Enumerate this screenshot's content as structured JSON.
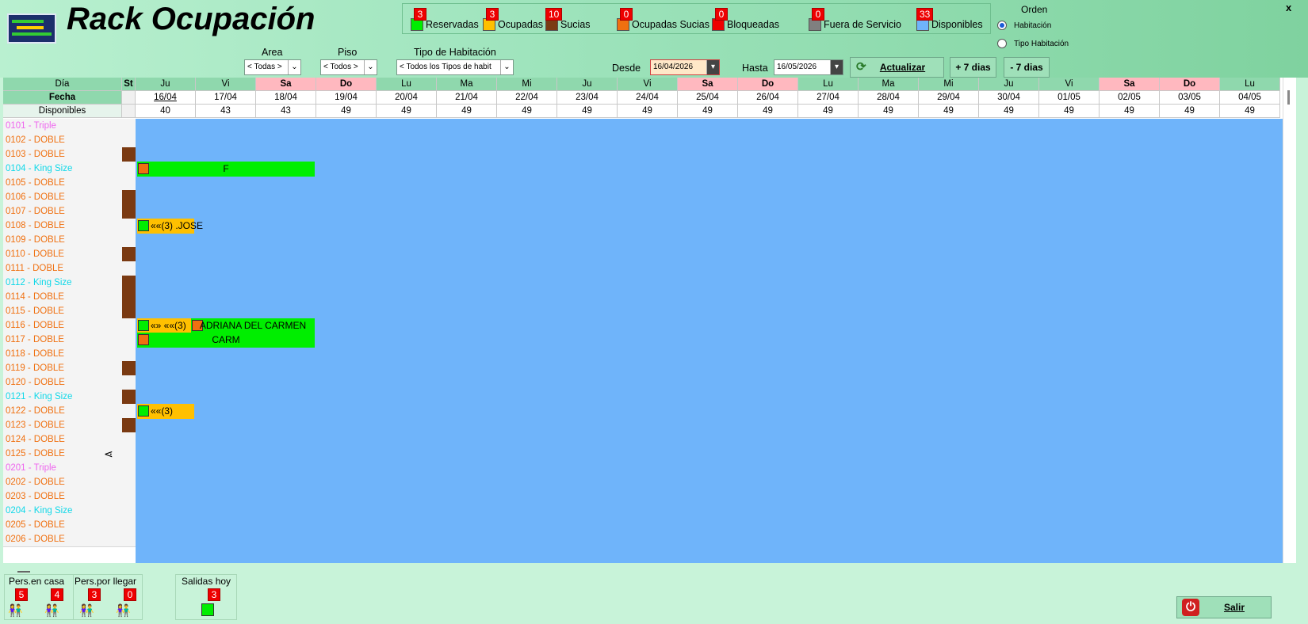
{
  "window": {
    "title": "Rack Ocupación",
    "close_label": "x"
  },
  "legend": [
    {
      "label": "Reservadas",
      "count": "3",
      "color": "#00ee00"
    },
    {
      "label": "Ocupadas",
      "count": "3",
      "color": "#ffc000"
    },
    {
      "label": "Sucias",
      "count": "10",
      "color": "#7a3a12"
    },
    {
      "label": "Ocupadas Sucias",
      "count": "0",
      "color": "#f07010"
    },
    {
      "label": "Bloqueadas",
      "count": "0",
      "color": "#ee0000"
    },
    {
      "label": "Fuera de Servicio",
      "count": "0",
      "color": "#808080"
    },
    {
      "label": "Disponibles",
      "count": "33",
      "color": "#6fb4fa"
    }
  ],
  "orden": {
    "title": "Orden",
    "options": [
      "Habitación",
      "Tipo Habitación"
    ],
    "selected": "Habitación"
  },
  "filters": {
    "area": {
      "label": "Area",
      "value": "< Todas >"
    },
    "piso": {
      "label": "Piso",
      "value": "< Todos >"
    },
    "tipo": {
      "label": "Tipo de Habitación",
      "value": "< Todos los Tipos de habit"
    },
    "desde": {
      "label": "Desde",
      "value": "16/04/2026"
    },
    "hasta": {
      "label": "Hasta",
      "value": "16/05/2026"
    }
  },
  "buttons": {
    "actualizar": "Actualizar",
    "mas7": "+ 7 dias",
    "menos7": "- 7 dias",
    "salir": "Salir"
  },
  "grid": {
    "header_labels": {
      "dia": "Día",
      "st": "St",
      "fecha": "Fecha",
      "disponibles": "Disponibles"
    },
    "days": [
      {
        "dia": "Ju",
        "fecha": "16/04",
        "disp": "40",
        "weekend": false
      },
      {
        "dia": "Vi",
        "fecha": "17/04",
        "disp": "43",
        "weekend": false
      },
      {
        "dia": "Sa",
        "fecha": "18/04",
        "disp": "43",
        "weekend": true
      },
      {
        "dia": "Do",
        "fecha": "19/04",
        "disp": "49",
        "weekend": true
      },
      {
        "dia": "Lu",
        "fecha": "20/04",
        "disp": "49",
        "weekend": false
      },
      {
        "dia": "Ma",
        "fecha": "21/04",
        "disp": "49",
        "weekend": false
      },
      {
        "dia": "Mi",
        "fecha": "22/04",
        "disp": "49",
        "weekend": false
      },
      {
        "dia": "Ju",
        "fecha": "23/04",
        "disp": "49",
        "weekend": false
      },
      {
        "dia": "Vi",
        "fecha": "24/04",
        "disp": "49",
        "weekend": false
      },
      {
        "dia": "Sa",
        "fecha": "25/04",
        "disp": "49",
        "weekend": true
      },
      {
        "dia": "Do",
        "fecha": "26/04",
        "disp": "49",
        "weekend": true
      },
      {
        "dia": "Lu",
        "fecha": "27/04",
        "disp": "49",
        "weekend": false
      },
      {
        "dia": "Ma",
        "fecha": "28/04",
        "disp": "49",
        "weekend": false
      },
      {
        "dia": "Mi",
        "fecha": "29/04",
        "disp": "49",
        "weekend": false
      },
      {
        "dia": "Ju",
        "fecha": "30/04",
        "disp": "49",
        "weekend": false
      },
      {
        "dia": "Vi",
        "fecha": "01/05",
        "disp": "49",
        "weekend": false
      },
      {
        "dia": "Sa",
        "fecha": "02/05",
        "disp": "49",
        "weekend": true
      },
      {
        "dia": "Do",
        "fecha": "03/05",
        "disp": "49",
        "weekend": true
      },
      {
        "dia": "Lu",
        "fecha": "04/05",
        "disp": "49",
        "weekend": false
      }
    ],
    "rooms": [
      {
        "name": "0101 - Triple",
        "type": "triple",
        "dirty": false
      },
      {
        "name": "0102 - DOBLE",
        "type": "doble",
        "dirty": false
      },
      {
        "name": "0103 - DOBLE",
        "type": "doble",
        "dirty": true
      },
      {
        "name": "0104 - King Size",
        "type": "king",
        "dirty": false
      },
      {
        "name": "0105 - DOBLE",
        "type": "doble",
        "dirty": false
      },
      {
        "name": "0106 - DOBLE",
        "type": "doble",
        "dirty": true
      },
      {
        "name": "0107 - DOBLE",
        "type": "doble",
        "dirty": true
      },
      {
        "name": "0108 - DOBLE",
        "type": "doble",
        "dirty": false
      },
      {
        "name": "0109 - DOBLE",
        "type": "doble",
        "dirty": false
      },
      {
        "name": "0110 - DOBLE",
        "type": "doble",
        "dirty": true
      },
      {
        "name": "0111 - DOBLE",
        "type": "doble",
        "dirty": false
      },
      {
        "name": "0112 - King Size",
        "type": "king",
        "dirty": true
      },
      {
        "name": "0114 - DOBLE",
        "type": "doble",
        "dirty": true
      },
      {
        "name": "0115 - DOBLE",
        "type": "doble",
        "dirty": true
      },
      {
        "name": "0116 - DOBLE",
        "type": "doble",
        "dirty": false
      },
      {
        "name": "0117 - DOBLE",
        "type": "doble",
        "dirty": false
      },
      {
        "name": "0118 - DOBLE",
        "type": "doble",
        "dirty": false
      },
      {
        "name": "0119 - DOBLE",
        "type": "doble",
        "dirty": true
      },
      {
        "name": "0120 - DOBLE",
        "type": "doble",
        "dirty": false
      },
      {
        "name": "0121 - King Size",
        "type": "king",
        "dirty": true
      },
      {
        "name": "0122 - DOBLE",
        "type": "doble",
        "dirty": false
      },
      {
        "name": "0123 - DOBLE",
        "type": "doble",
        "dirty": true
      },
      {
        "name": "0124 - DOBLE",
        "type": "doble",
        "dirty": false
      },
      {
        "name": "0125 - DOBLE",
        "type": "doble",
        "dirty": false,
        "share": true
      },
      {
        "name": "0201 - Triple",
        "type": "triple",
        "dirty": false
      },
      {
        "name": "0202 - DOBLE",
        "type": "doble",
        "dirty": false
      },
      {
        "name": "0203 - DOBLE",
        "type": "doble",
        "dirty": false
      },
      {
        "name": "0204 - King Size",
        "type": "king",
        "dirty": false
      },
      {
        "name": "0205 - DOBLE",
        "type": "doble",
        "dirty": false
      },
      {
        "name": "0206 - DOBLE",
        "type": "doble",
        "dirty": false
      }
    ],
    "room_type_colors": {
      "triple": "#ee66ee",
      "doble": "#f07010",
      "king": "#10d8e8"
    },
    "reservations": [
      {
        "row": 3,
        "start": 0,
        "span": 3,
        "status": "Reservadas",
        "text": "F",
        "mini": "Ocupadas Sucias"
      },
      {
        "row": 7,
        "start": 0,
        "span": 1,
        "status": "Ocupadas",
        "text": "««(3) .JOSE",
        "mini": "Reservadas"
      },
      {
        "row": 14,
        "start": 0,
        "span": 1,
        "status": "Ocupadas",
        "text": "«» ««(3)",
        "mini": "Reservadas"
      },
      {
        "row": 14,
        "start": 1,
        "span": 2,
        "status": "Reservadas",
        "text": "ADRIANA DEL CARMEN",
        "mini": "Ocupadas Sucias"
      },
      {
        "row": 15,
        "start": 0,
        "span": 3,
        "status": "Reservadas",
        "text": "CARM",
        "mini": "Ocupadas Sucias"
      },
      {
        "row": 20,
        "start": 0,
        "span": 1,
        "status": "Ocupadas",
        "text": "««(3)",
        "mini": "Reservadas"
      }
    ]
  },
  "footer": {
    "pers_en_casa": {
      "label": "Pers.en casa",
      "adults": "5",
      "kids": "4"
    },
    "pers_por_llegar": {
      "label": "Pers.por llegar",
      "adults": "3",
      "kids": "0"
    },
    "salidas_hoy": {
      "label": "Salidas hoy",
      "count": "3"
    }
  }
}
